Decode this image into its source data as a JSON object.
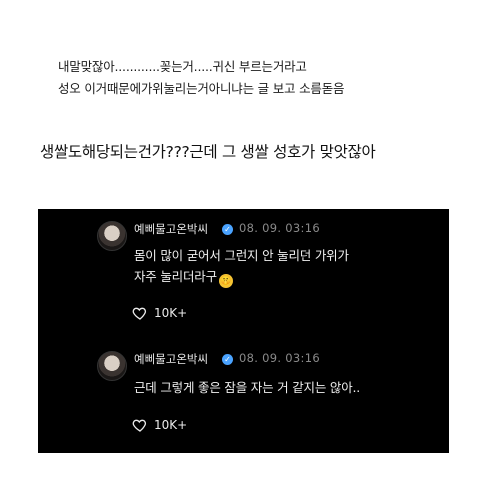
{
  "intro": {
    "line1": "내말맞잖아............꽂는거.....귀신 부르는거라고",
    "line2": "성오 이거때문에가위눌리는거아니냐는 글 보고 소름돋음"
  },
  "headline": "생쌀도해당되는건가???근데 그 생쌀 성호가 맞앗잖아",
  "posts": [
    {
      "username": "예삐물고온박씨",
      "timestamp": "08. 09. 03:16",
      "lines": [
        "몸이 많이 굳어서 그런지 안 눌리던 가위가",
        "자주 눌리더라구"
      ],
      "emoji": "🤫",
      "likes": "10K+"
    },
    {
      "username": "예삐물고온박씨",
      "timestamp": "08. 09. 03:16",
      "lines": [
        "근데 그렇게 좋은 잠을 자는 거 같지는 않아.."
      ],
      "likes": "10K+"
    }
  ],
  "colors": {
    "background": "#ffffff",
    "screenshot_bg": "#000000",
    "verified": "#4aa3ff"
  },
  "icons": {
    "heart": "heart-outline-icon",
    "verified": "verified-badge-icon"
  }
}
